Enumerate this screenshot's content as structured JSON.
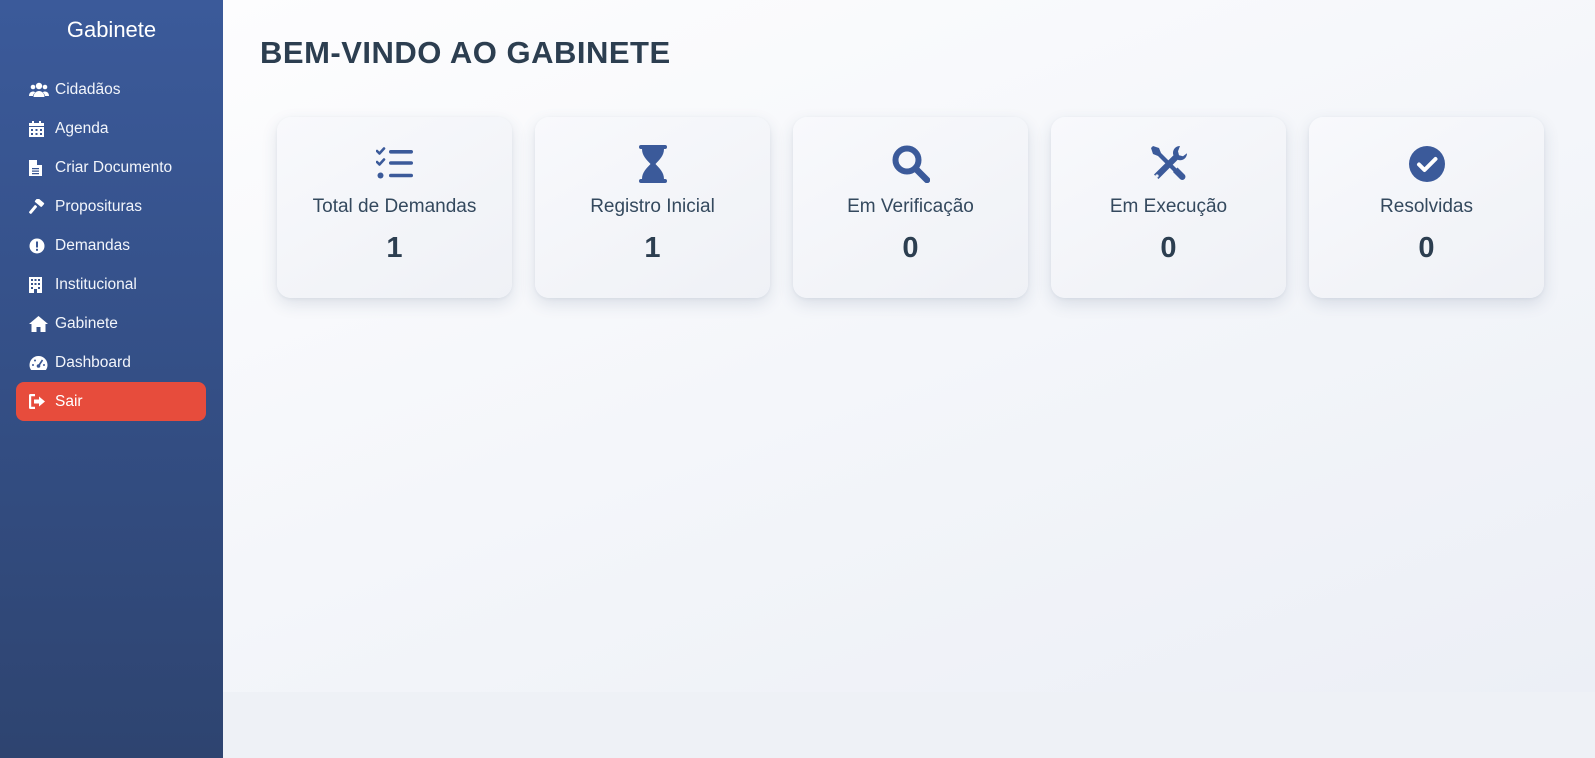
{
  "sidebar": {
    "title": "Gabinete",
    "items": [
      {
        "label": "Cidadãos",
        "icon": "users-icon"
      },
      {
        "label": "Agenda",
        "icon": "calendar-icon"
      },
      {
        "label": "Criar Documento",
        "icon": "document-icon"
      },
      {
        "label": "Proposituras",
        "icon": "gavel-icon"
      },
      {
        "label": "Demandas",
        "icon": "exclamation-circle-icon"
      },
      {
        "label": "Institucional",
        "icon": "building-icon"
      },
      {
        "label": "Gabinete",
        "icon": "home-icon"
      },
      {
        "label": "Dashboard",
        "icon": "gauge-icon"
      }
    ],
    "logout": {
      "label": "Sair",
      "icon": "sign-out-icon"
    }
  },
  "main": {
    "title": "BEM-VINDO AO GABINETE",
    "cards": [
      {
        "label": "Total de Demandas",
        "value": "1",
        "icon": "list-check-icon"
      },
      {
        "label": "Registro Inicial",
        "value": "1",
        "icon": "hourglass-icon"
      },
      {
        "label": "Em Verificação",
        "value": "0",
        "icon": "search-icon"
      },
      {
        "label": "Em Execução",
        "value": "0",
        "icon": "tools-icon"
      },
      {
        "label": "Resolvidas",
        "value": "0",
        "icon": "check-circle-icon"
      }
    ]
  },
  "colors": {
    "sidebar_top": "#3b5a9a",
    "sidebar_bottom": "#2e4470",
    "logout": "#e74c3c",
    "icon_accent": "#3b5a9a",
    "title_text": "#2c3e50"
  }
}
